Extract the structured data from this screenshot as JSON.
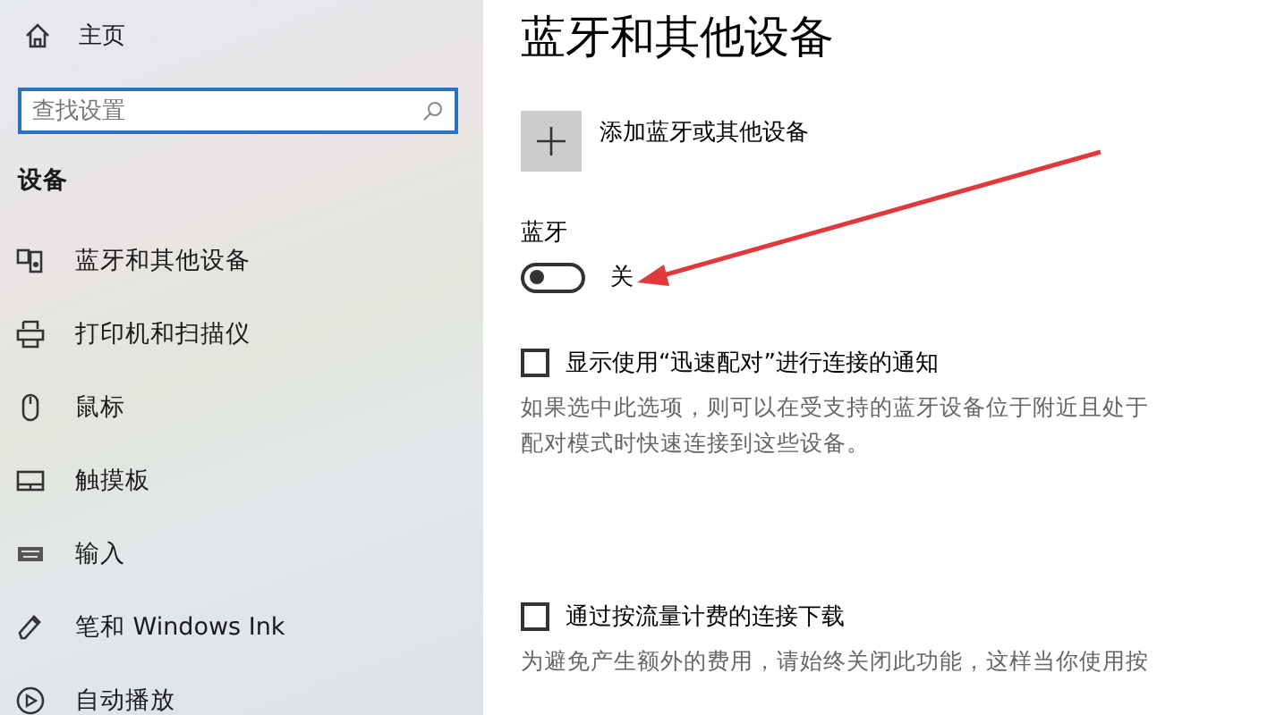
{
  "sidebar": {
    "home": "主页",
    "search": {
      "placeholder": "查找设置"
    },
    "section": "设备",
    "items": [
      {
        "label": "蓝牙和其他设备",
        "kind": "bluetooth",
        "selected": false
      },
      {
        "label": "打印机和扫描仪",
        "kind": "printer",
        "selected": false
      },
      {
        "label": "鼠标",
        "kind": "mouse",
        "selected": false
      },
      {
        "label": "触摸板",
        "kind": "touchpad",
        "selected": false
      },
      {
        "label": "输入",
        "kind": "keyboard",
        "selected": false
      },
      {
        "label": "笔和 Windows Ink",
        "kind": "pen",
        "selected": false
      },
      {
        "label": "自动播放",
        "kind": "autoplay",
        "selected": false
      }
    ]
  },
  "page": {
    "title": "蓝牙和其他设备",
    "add_device": "添加蓝牙或其他设备",
    "bluetooth": {
      "label": "蓝牙",
      "on": false,
      "state_text": "关"
    },
    "options": [
      {
        "label": "显示使用“迅速配对”进行连接的通知",
        "checked": false,
        "description": "如果选中此选项，则可以在受支持的蓝牙设备位于附近且处于配对模式时快速连接到这些设备。"
      },
      {
        "label": "通过按流量计费的连接下载",
        "checked": false,
        "description": "为避免产生额外的费用，请始终关闭此功能，这样当你使用按"
      }
    ]
  }
}
